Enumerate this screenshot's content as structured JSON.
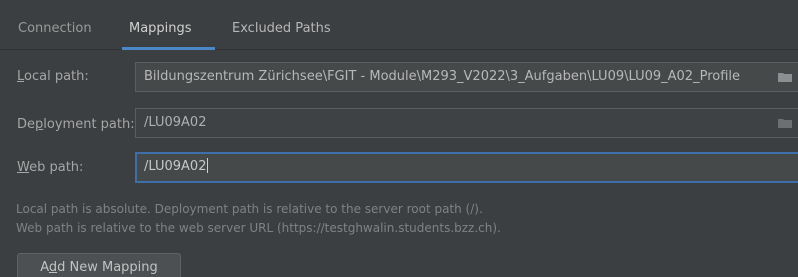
{
  "tabs": [
    {
      "label": "Connection"
    },
    {
      "label": "Mappings",
      "active": true
    },
    {
      "label": "Excluded Paths"
    }
  ],
  "form": {
    "local_path": {
      "label_mnemonic": "L",
      "label_rest": "ocal path:",
      "value": "Bildungszentrum Zürichsee\\FGIT - Module\\M293_V2022\\3_Aufgaben\\LU09\\LU09_A02_Profile"
    },
    "deployment_path": {
      "label_pre": "De",
      "label_mnemonic": "p",
      "label_rest": "loyment path:",
      "value": "/LU09A02"
    },
    "web_path": {
      "label_mnemonic": "W",
      "label_rest": "eb path:",
      "value": "/LU09A02"
    }
  },
  "hints": [
    "Local path is absolute. Deployment path is relative to the server root path (/).",
    "Web path is relative to the web server URL (https://testghwalin.students.bzz.ch)."
  ],
  "add_button": {
    "pre": "A",
    "mnemonic": "d",
    "rest": "d New Mapping"
  },
  "colors": {
    "background": "#3c3f41",
    "accent": "#4a88c7",
    "field_bg": "#45494a"
  },
  "icons": [
    "folder-icon"
  ]
}
